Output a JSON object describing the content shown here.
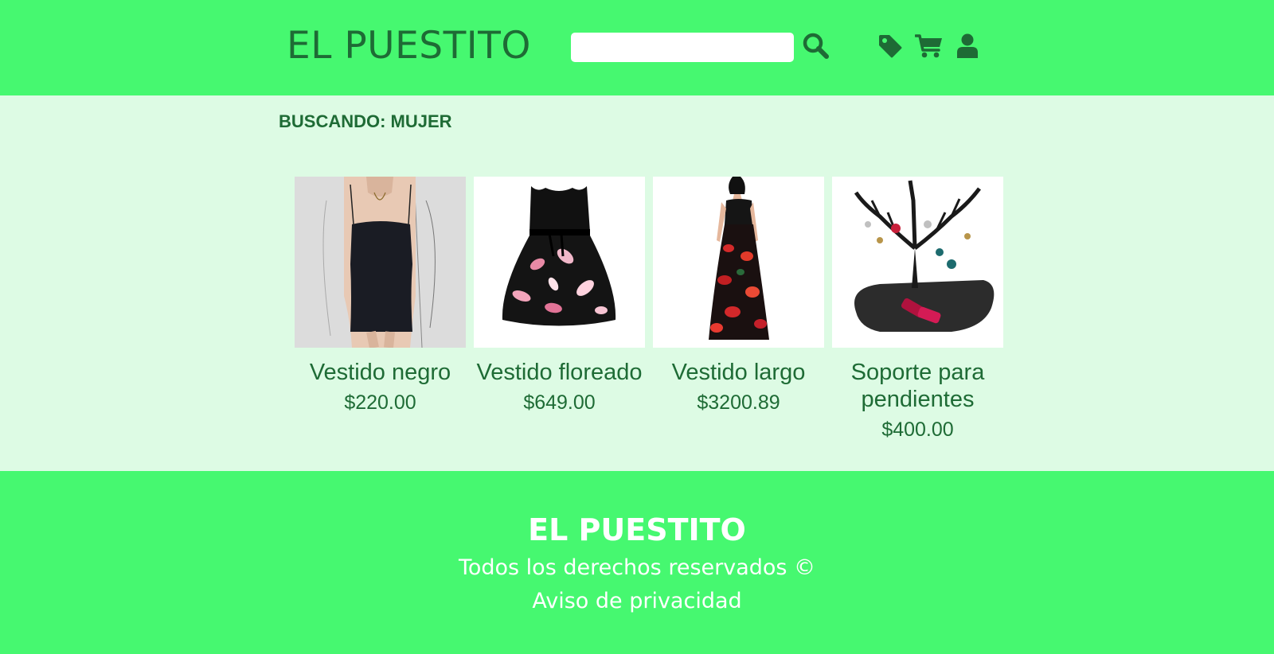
{
  "header": {
    "logo": "EL PUESTITO",
    "search_value": "",
    "icons": [
      "search-icon",
      "tag-icon",
      "cart-icon",
      "user-icon"
    ]
  },
  "search": {
    "label": "BUSCANDO: MUJER"
  },
  "products": [
    {
      "name": "Vestido negro",
      "price": "$220.00",
      "image": "black-slip-dress"
    },
    {
      "name": "Vestido floreado",
      "price": "$649.00",
      "image": "floral-dress"
    },
    {
      "name": "Vestido largo",
      "price": "$3200.89",
      "image": "long-red-floral-dress"
    },
    {
      "name": "Soporte para pendientes",
      "price": "$400.00",
      "image": "earring-tree-stand"
    }
  ],
  "footer": {
    "title": "EL PUESTITO",
    "rights": "Todos los derechos reservados ©",
    "privacy": "Aviso de privacidad"
  },
  "colors": {
    "header_bg": "#46f870",
    "page_bg": "#ddfbe4",
    "text_dark_green": "#1e6b35",
    "footer_text": "#ffffff"
  }
}
